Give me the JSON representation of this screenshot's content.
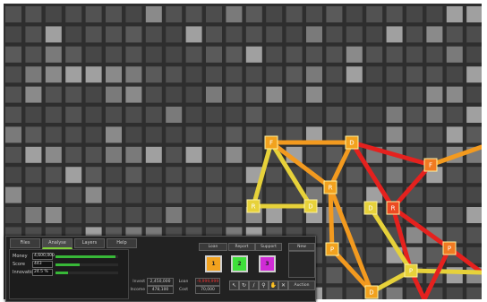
{
  "tabs": [
    "Files",
    "Analyse",
    "Layers",
    "Help"
  ],
  "stats": [
    {
      "label": "Money",
      "value": "4,600,000",
      "level": 0.95
    },
    {
      "label": "Score",
      "value": "443",
      "level": 0.38
    },
    {
      "label": "Innovation",
      "value": "24.5 %",
      "level": 0.2
    }
  ],
  "actions": {
    "loan": "Loan",
    "report": "Report",
    "support": "Support",
    "news": "New"
  },
  "choices": [
    {
      "label": "1",
      "color": "#f2a21e"
    },
    {
      "label": "2",
      "color": "#3fe03a"
    },
    {
      "label": "3",
      "color": "#d02bd6"
    }
  ],
  "finance": {
    "invest_label": "Invest",
    "invest_value": "2,450,000",
    "loan_label": "Loan",
    "loan_value": "-9,999,999",
    "income_label": "Income",
    "income_value": "478,100",
    "cost_label": "Cost",
    "cost_value": "70,000"
  },
  "auction_label": "Auction",
  "tools": [
    "pointer-icon",
    "rotate-icon",
    "line-icon",
    "zoom-icon",
    "hand-icon",
    "delete-icon"
  ],
  "nodes": [
    {
      "label": "F",
      "color": "#f2a21e"
    },
    {
      "label": "D",
      "color": "#f2a21e"
    },
    {
      "label": "R",
      "color": "#e7d23a"
    },
    {
      "label": "D",
      "color": "#e7d23a"
    },
    {
      "label": "R",
      "color": "#f2a21e"
    },
    {
      "label": "D",
      "color": "#e7d23a"
    },
    {
      "label": "R",
      "color": "#ec4a22"
    },
    {
      "label": "F",
      "color": "#f07a22"
    },
    {
      "label": "P",
      "color": "#f2a21e"
    },
    {
      "label": "P",
      "color": "#e7d23a"
    },
    {
      "label": "P",
      "color": "#f07a22"
    },
    {
      "label": "D",
      "color": "#f2a21e"
    }
  ],
  "colors": {
    "red": "#e5211e",
    "orange": "#f39a1f",
    "yellow": "#e7d23a",
    "background": "#2e2e2e"
  }
}
